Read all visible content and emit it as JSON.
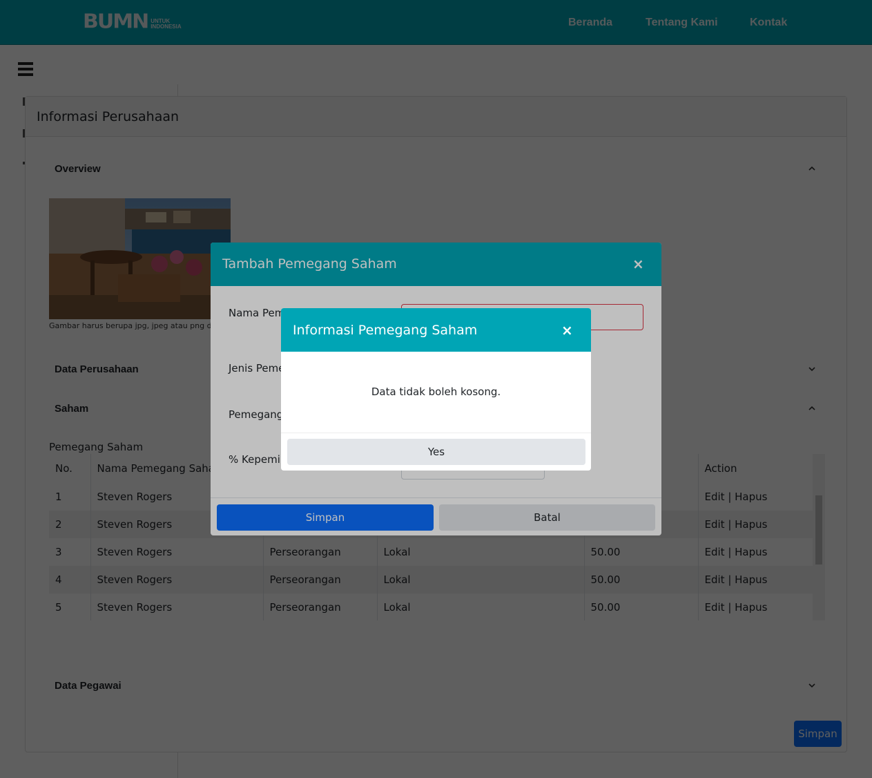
{
  "header": {
    "logo_main": "BUMN",
    "logo_sub_line1": "UNTUK",
    "logo_sub_line2": "INDONESIA",
    "nav": [
      "Beranda",
      "Tentang Kami",
      "Kontak"
    ]
  },
  "card": {
    "title": "Informasi Perusahaan",
    "sections": {
      "overview": "Overview",
      "data_perusahaan": "Data Perusahaan",
      "saham": "Saham",
      "data_pegawai": "Data Pegawai"
    },
    "photo_note": "Gambar harus berupa jpg, jpeg atau png den",
    "pemegang_saham_label": "Pemegang Saham",
    "table": {
      "headers": [
        "No.",
        "Nama Pemegang Saham",
        "",
        "",
        "",
        "Action"
      ],
      "rows": [
        [
          "1",
          "Steven Rogers",
          "",
          "",
          "",
          "Edit | Hapus"
        ],
        [
          "2",
          "Steven Rogers",
          "",
          "",
          "",
          "Edit | Hapus"
        ],
        [
          "3",
          "Steven Rogers",
          "Perseorangan",
          "Lokal",
          "50.00",
          "Edit | Hapus"
        ],
        [
          "4",
          "Steven Rogers",
          "Perseorangan",
          "Lokal",
          "50.00",
          "Edit | Hapus"
        ],
        [
          "5",
          "Steven Rogers",
          "Perseorangan",
          "Lokal",
          "50.00",
          "Edit | Hapus"
        ]
      ]
    },
    "save_label": "Simpan"
  },
  "modal_tambah": {
    "title": "Tambah Pemegang Saham",
    "close": "×",
    "labels": [
      "Nama Pem",
      "Jenis Peme",
      "Pemegang",
      "% Kepemil"
    ],
    "save_label": "Simpan",
    "cancel_label": "Batal"
  },
  "modal_info": {
    "title": "Informasi Pemegang Saham",
    "close": "×",
    "message": "Data tidak boleh kosong.",
    "yes_label": "Yes"
  },
  "colors": {
    "header_teal": "#00a5b5",
    "primary_blue": "#0d6efd",
    "secondary_gray": "#e2e5e9"
  }
}
